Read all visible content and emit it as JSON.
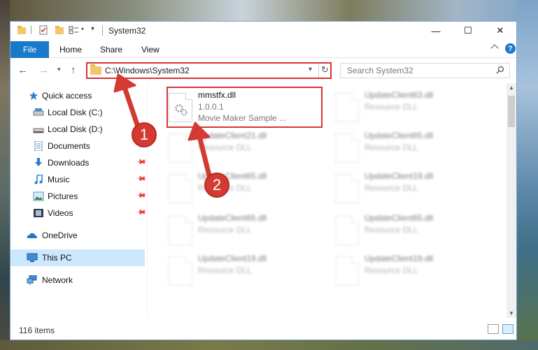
{
  "window": {
    "title": "System32",
    "controls": {
      "minimize": "—",
      "maximize": "☐",
      "close": "✕"
    }
  },
  "ribbon": {
    "tabs": [
      "File",
      "Home",
      "Share",
      "View"
    ],
    "help": "?"
  },
  "nav": {
    "back": "←",
    "forward": "→",
    "recent": "▾",
    "up": "↑",
    "address": "C:\\Windows\\System32",
    "address_dropdown": "▾",
    "refresh": "↻",
    "search_placeholder": "Search System32"
  },
  "sidebar": {
    "items": [
      {
        "label": "Quick access",
        "icon": "star-icon",
        "pinned": false
      },
      {
        "label": "Local Disk (C:)",
        "icon": "drive-icon",
        "pinned": false
      },
      {
        "label": "Local Disk (D:)",
        "icon": "drive-icon",
        "pinned": false
      },
      {
        "label": "Documents",
        "icon": "documents-icon",
        "pinned": true
      },
      {
        "label": "Downloads",
        "icon": "downloads-icon",
        "pinned": true
      },
      {
        "label": "Music",
        "icon": "music-icon",
        "pinned": true
      },
      {
        "label": "Pictures",
        "icon": "pictures-icon",
        "pinned": true
      },
      {
        "label": "Videos",
        "icon": "videos-icon",
        "pinned": true
      },
      {
        "label": "OneDrive",
        "icon": "onedrive-icon",
        "pinned": false
      },
      {
        "label": "This PC",
        "icon": "this-pc-icon",
        "pinned": false,
        "selected": true
      },
      {
        "label": "Network",
        "icon": "network-icon",
        "pinned": false
      }
    ]
  },
  "files": {
    "highlighted": {
      "name": "mmstfx.dll",
      "version": "1.0.0.1",
      "description": "Movie Maker Sample ..."
    },
    "blurred": [
      {
        "name": "UpdateClient63.dll",
        "type": "Resource DLL"
      },
      {
        "name": "UpdateClient21.dll",
        "type": "Resource DLL"
      },
      {
        "name": "UpdateClient65.dll",
        "type": "Resource DLL"
      },
      {
        "name": "UpdateClient65.dll",
        "type": "Resource DLL"
      },
      {
        "name": "UpdateClient19.dll",
        "type": "Resource DLL"
      },
      {
        "name": "UpdateClient65.dll",
        "type": "Resource DLL"
      },
      {
        "name": "UpdateClient65.dll",
        "type": "Resource DLL"
      },
      {
        "name": "UpdateClient19.dll",
        "type": "Resource DLL"
      },
      {
        "name": "UpdateClient19.dll",
        "type": "Resource DLL"
      }
    ]
  },
  "status": {
    "item_count": "116 items"
  },
  "annotations": {
    "step1": "1",
    "step2": "2"
  },
  "colors": {
    "accent": "#1979ca",
    "highlight": "#d93434",
    "selected": "#cce8ff"
  }
}
